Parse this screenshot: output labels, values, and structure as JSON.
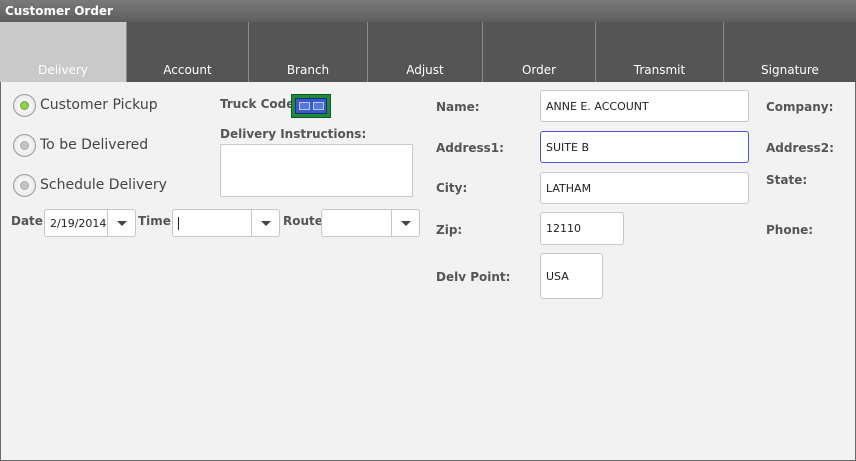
{
  "window": {
    "title": "Customer Order"
  },
  "tabs": [
    {
      "label": "Delivery",
      "active": true
    },
    {
      "label": "Account"
    },
    {
      "label": "Branch"
    },
    {
      "label": "Adjust"
    },
    {
      "label": "Order"
    },
    {
      "label": "Transmit"
    },
    {
      "label": "Signature"
    }
  ],
  "delivery": {
    "options": [
      {
        "label": "Customer Pickup",
        "checked": true
      },
      {
        "label": "To be Delivered",
        "checked": false
      },
      {
        "label": "Schedule Delivery",
        "checked": false
      }
    ],
    "truck_code_label": "Truck Code:",
    "instructions_label": "Delivery Instructions:",
    "instructions_value": "",
    "date_label": "Date:",
    "date_value": "2/19/2014",
    "time_label": "Time:",
    "time_value": "",
    "route_label": "Route:",
    "route_value": ""
  },
  "address": {
    "name_label": "Name:",
    "name_value": "ANNE E. ACCOUNT",
    "address1_label": "Address1:",
    "address1_value": "SUITE B",
    "city_label": "City:",
    "city_value": "LATHAM",
    "zip_label": "Zip:",
    "zip_value": "12110",
    "delv_point_label": "Delv Point:",
    "delv_point_value": "USA",
    "company_label": "Company:",
    "address2_label": "Address2:",
    "state_label": "State:",
    "phone_label": "Phone:"
  },
  "colors": {
    "active_radio": "#8fd14f",
    "focus_border": "#4a56d6",
    "truck_button": "#3a5cc8"
  }
}
